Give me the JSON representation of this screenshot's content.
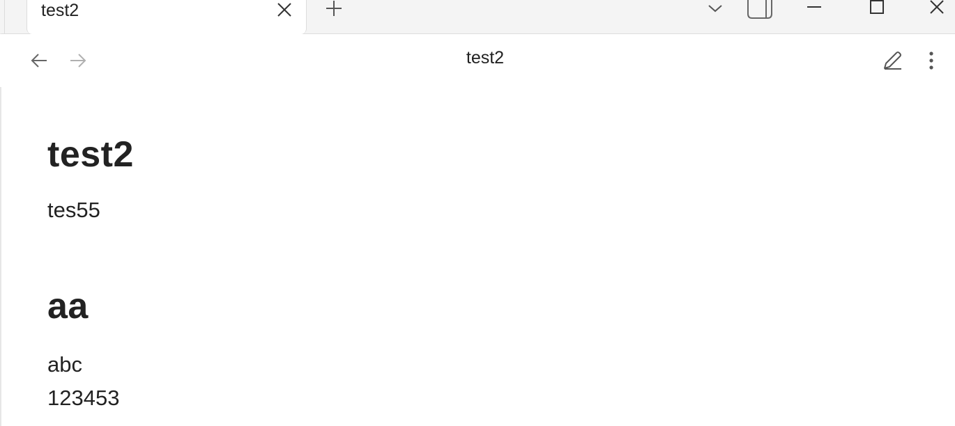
{
  "tab": {
    "title": "test2"
  },
  "toolbar": {
    "title": "test2"
  },
  "note": {
    "heading1": "test2",
    "paragraph1": "tes55",
    "heading2": "aa",
    "line1": "abc",
    "line2": "123453"
  },
  "icons": {
    "tab_close": "close-icon",
    "new_tab": "plus-icon",
    "tab_list": "chevron-down-icon",
    "sidebar_toggle": "sidebar-icon",
    "minimize": "minimize-icon",
    "maximize": "maximize-icon",
    "close_window": "close-icon",
    "back": "arrow-left-icon",
    "forward": "arrow-right-icon",
    "edit": "pencil-icon",
    "more": "more-vertical-icon"
  },
  "colors": {
    "text": "#222222",
    "muted_icon": "#666666",
    "disabled_icon": "#b0b0b0",
    "tabstrip_bg": "#f4f4f4",
    "border": "#dcdcdc"
  }
}
